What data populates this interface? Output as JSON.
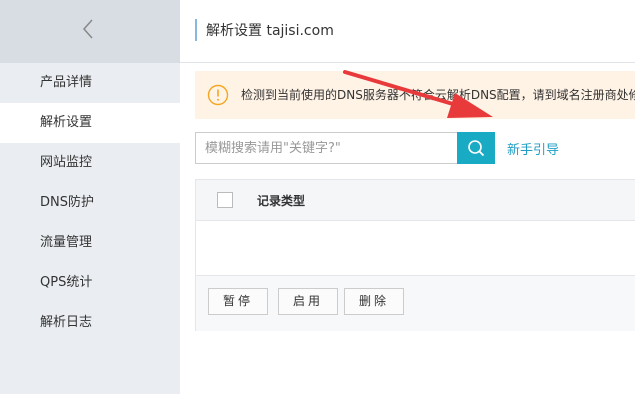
{
  "sidebar": {
    "back_icon": "chevron-left-icon",
    "items": [
      {
        "label": "产品详情",
        "active": false
      },
      {
        "label": "解析设置",
        "active": true
      },
      {
        "label": "网站监控",
        "active": false
      },
      {
        "label": "DNS防护",
        "active": false
      },
      {
        "label": "流量管理",
        "active": false
      },
      {
        "label": "QPS统计",
        "active": false
      },
      {
        "label": "解析日志",
        "active": false
      }
    ]
  },
  "header": {
    "title": "解析设置 tajisi.com"
  },
  "notice": {
    "icon": "warning-circle-icon",
    "text": "检测到当前使用的DNS服务器不符合云解析DNS配置，请到域名注册商处修改"
  },
  "search": {
    "placeholder": "模糊搜索请用\"关键字?\"",
    "button_icon": "search-icon"
  },
  "guide_link": "新手引导",
  "table": {
    "columns": [
      "记录类型"
    ]
  },
  "actions": {
    "pause": "暂停",
    "enable": "启用",
    "delete": "删除"
  },
  "colors": {
    "accent": "#19aac4",
    "link": "#1f9ec4",
    "warning": "#f5a623",
    "annotation_arrow": "#e8393b"
  }
}
